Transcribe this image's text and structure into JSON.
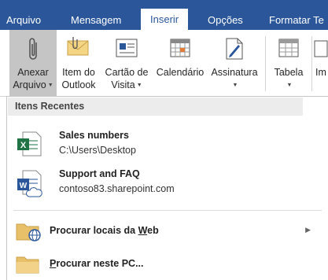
{
  "tabs": [
    "Arquivo",
    "Mensagem",
    "Inserir",
    "Opções",
    "Formatar Te"
  ],
  "ribbon": {
    "buttons": [
      {
        "line1": "Anexar",
        "line2": "Arquivo",
        "icon": "paperclip-icon"
      },
      {
        "line1": "Item do",
        "line2": "Outlook",
        "icon": "outlook-item-icon"
      },
      {
        "line1": "Cartão de",
        "line2": "Visita",
        "icon": "business-card-icon"
      },
      {
        "line1": "Calendário",
        "line2": "",
        "icon": "calendar-icon"
      },
      {
        "line1": "Assinatura",
        "line2": "",
        "icon": "signature-icon"
      },
      {
        "line1": "Tabela",
        "line2": "",
        "icon": "table-icon"
      },
      {
        "line1": "Im",
        "line2": "",
        "icon": "image-icon"
      }
    ]
  },
  "panel": {
    "header": "Itens Recentes",
    "recent": [
      {
        "name": "Sales numbers",
        "path": "C:\\Users\\Desktop",
        "icon": "excel-file-icon"
      },
      {
        "name": "Support and FAQ",
        "path": "contoso83.sharepoint.com",
        "icon": "word-file-icon"
      }
    ],
    "actions": [
      {
        "prefix": "Procurar locais da ",
        "key": "W",
        "suffix": "eb",
        "icon": "web-folder-icon"
      },
      {
        "prefix": "",
        "key": "P",
        "suffix": "rocurar neste PC...",
        "icon": "folder-icon"
      }
    ]
  },
  "colors": {
    "accent": "#2b579a",
    "excel": "#217346",
    "word": "#2b579a",
    "folder": "#e8c06a"
  }
}
